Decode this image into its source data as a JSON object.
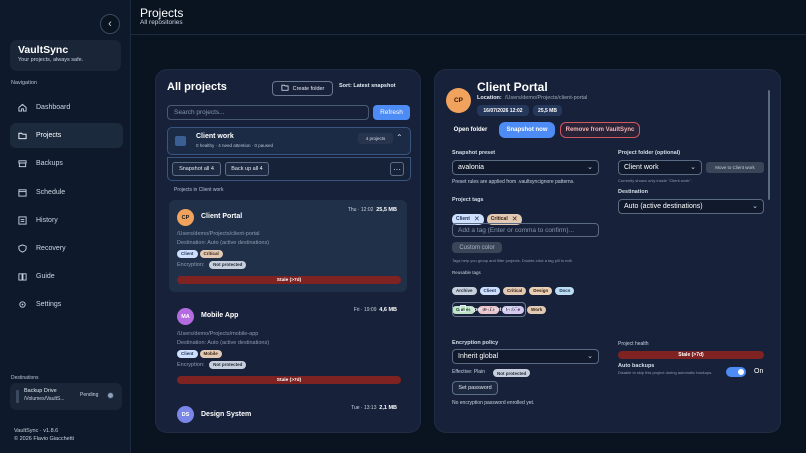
{
  "sidebar": {
    "brand_title": "VaultSync",
    "brand_subtitle": "Your projects, always safe.",
    "nav_heading": "Navigation",
    "items": [
      {
        "label": "Dashboard",
        "icon": "home-icon"
      },
      {
        "label": "Projects",
        "icon": "folder-icon"
      },
      {
        "label": "Backups",
        "icon": "archive-icon"
      },
      {
        "label": "Schedule",
        "icon": "calendar-icon"
      },
      {
        "label": "History",
        "icon": "list-icon"
      },
      {
        "label": "Recovery",
        "icon": "shield-icon"
      },
      {
        "label": "Guide",
        "icon": "book-icon"
      },
      {
        "label": "Settings",
        "icon": "gear-icon"
      }
    ],
    "active_item": "Projects",
    "destinations_heading": "Destinations",
    "destination": {
      "name": "Backup Drive",
      "path": "/Volumes/VaultS...",
      "status": "Pending"
    },
    "version": "VaultSync · v1.8.6",
    "copyright": "© 2026 Flavio Giacchetti"
  },
  "header": {
    "title": "Projects",
    "subtitle": "All repositories"
  },
  "list_panel": {
    "title": "All projects",
    "create_folder": "Create folder",
    "sort": "Sort: Latest snapshot",
    "search_placeholder": "Search projects...",
    "refresh": "Refresh",
    "group": {
      "name": "Client work",
      "summary": "0 healthy · 4 need attention · 0 paused",
      "count": "4 projects"
    },
    "snapshot_all": "Snapshot all 4",
    "backup_all": "Back up all 4",
    "more": "···",
    "section_label": "Projects in Client work",
    "projects": [
      {
        "initials": "CP",
        "name": "Client Portal",
        "time": "Thu · 12:02",
        "size": "25,5 MB",
        "path": "/Users/demo/Projects/client-portal",
        "destination": "Destination: Auto (active destinations)",
        "tags": [
          "Client",
          "Critical"
        ],
        "encryption_label": "Encryption:",
        "encryption": "Not protected",
        "health": "Stale (>7d)",
        "avatar_color": "#f1a25c"
      },
      {
        "initials": "MA",
        "name": "Mobile App",
        "time": "Fri · 19:09",
        "size": "4,6 MB",
        "path": "/Users/demo/Projects/mobile-app",
        "destination": "Destination: Auto (active destinations)",
        "tags": [
          "Client",
          "Mobile"
        ],
        "encryption_label": "Encryption:",
        "encryption": "Not protected",
        "health": "Stale (>7d)",
        "avatar_color": "#b46be0"
      },
      {
        "initials": "DS",
        "name": "Design System",
        "time": "Tue · 13:13",
        "size": "2,1 MB",
        "avatar_color": "#7a86e8"
      }
    ]
  },
  "detail": {
    "initials": "CP",
    "name": "Client Portal",
    "location_label": "Location:",
    "location": "/Users/demo/Projects/client-portal",
    "date_badge": "16/07/2026 12:02",
    "size_badge": "25,5 MB",
    "open_folder": "Open folder",
    "snapshot_now": "Snapshot now",
    "remove": "Remove from VaultSync",
    "snapshot_preset_label": "Snapshot preset",
    "snapshot_preset_value": "avalonia",
    "preset_hint": "Preset rules are applied from .vaultsyncignore patterns.",
    "project_tags_label": "Project tags",
    "selected_tags": [
      "Client",
      "Critical"
    ],
    "tag_placeholder": "Add a tag (Enter or comma to confirm)...",
    "custom_color": "Custom color",
    "tags_hint": "Tags help you group and filter projects. Double-click a tag pill to edit.",
    "reusable_tags_label": "Reusable tags",
    "reusable_tags": [
      "Archive",
      "Client",
      "Critical",
      "Design",
      "Docs",
      "Games",
      "Media",
      "Mobile",
      "Work"
    ],
    "open_preset_editor": "Open preset editor",
    "project_folder_label": "Project folder (optional)",
    "project_folder_value": "Client work",
    "move_to_folder": "Move to Client work",
    "folder_hint": "Currently shown only inside \"Client work\".",
    "destination_label": "Destination",
    "destination_value": "Auto (active destinations)",
    "encryption_policy_label": "Encryption policy",
    "encryption_policy_value": "Inherit global",
    "effective_label": "Effective: Plain",
    "effective_badge": "Not protected",
    "set_password": "Set password",
    "no_password": "No encryption password enrolled yet.",
    "project_health_label": "Project health",
    "project_health_value": "Stale (>7d)",
    "auto_backups_label": "Auto backups",
    "auto_backups_hint": "Disable to skip this project during automatic backups.",
    "auto_backups_state": "On"
  },
  "colors": {
    "accent": "#4d8bf5",
    "stale": "#7e2222",
    "danger_outline": "#d0575d"
  }
}
